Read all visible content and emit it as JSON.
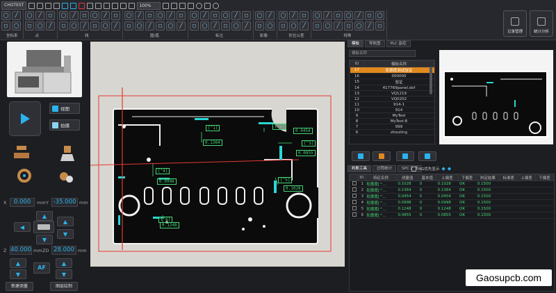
{
  "app": {
    "name": "CHOTEST",
    "zoom": "100%"
  },
  "toolbar": {
    "groups": [
      {
        "label": "坐标系",
        "icons": [
          "axis",
          "axis",
          "axis",
          "axis"
        ]
      },
      {
        "label": "点",
        "icons": [
          "point",
          "point",
          "point",
          "point",
          "point",
          "point"
        ]
      },
      {
        "label": "线",
        "icons": [
          "line",
          "line",
          "line",
          "line",
          "line",
          "line",
          "line",
          "line",
          "line",
          "line",
          "line",
          "line"
        ]
      },
      {
        "label": "圆/弧",
        "icons": [
          "circle",
          "circle",
          "circle",
          "circle",
          "circle",
          "circle",
          "circle",
          "circle",
          "circle",
          "circle",
          "circle",
          "circle"
        ]
      },
      {
        "label": "标注",
        "icons": [
          "dim",
          "dim",
          "dim",
          "dim",
          "dim",
          "dim",
          "dim",
          "dim",
          "dim",
          "dim",
          "dim",
          "dim"
        ]
      },
      {
        "label": "影像",
        "icons": [
          "img",
          "img",
          "img",
          "img"
        ]
      },
      {
        "label": "形位公差",
        "icons": [
          "tol",
          "tol",
          "tol",
          "tol",
          "tol",
          "tol"
        ]
      },
      {
        "label": "特殊",
        "icons": [
          "spec",
          "spec",
          "spec",
          "spec",
          "spec",
          "spec",
          "spec",
          "spec",
          "spec",
          "spec",
          "spec",
          "spec",
          "spec",
          "spec"
        ]
      }
    ],
    "right_buttons": [
      "记录管理",
      "统计分析"
    ]
  },
  "left": {
    "view_button": "视图",
    "shoot_button": "拍摄",
    "x_label": "X",
    "x_value": "0.000",
    "x_unit": "mm",
    "y_label": "Y",
    "y_value": "-35.000",
    "y_unit": "mm",
    "z_label": "Z",
    "z_value": "40.000",
    "z_unit": "mm",
    "zd_label": "ZD",
    "zd_value": "28.000",
    "zd_unit": "mm",
    "af_label": "AF",
    "new_measure": "新建测量",
    "image_measure": "图层绘制"
  },
  "canvas": {
    "measurements": [
      "0.1364",
      "0.0454",
      "0.0855",
      "0.0998",
      "0.1028",
      "0.1248"
    ],
    "labels": [
      "[^1]",
      "[^2]",
      "[^3]",
      "[^4]",
      "[^5]",
      "[^6]"
    ]
  },
  "right": {
    "tabs_top": [
      "模板",
      "导航图",
      "PLC 监控"
    ],
    "template_search_placeholder": "模板名称",
    "tmpl_headers": [
      "ID",
      "模板名称"
    ],
    "templates": [
      {
        "id": "17",
        "name": "轮廓度测试验证"
      },
      {
        "id": "16",
        "name": "000000"
      },
      {
        "id": "15",
        "name": "验证"
      },
      {
        "id": "14",
        "name": "417769panel.dxf"
      },
      {
        "id": "13",
        "name": "VQ1219"
      },
      {
        "id": "12",
        "name": "VQ0202"
      },
      {
        "id": "11",
        "name": "914-1"
      },
      {
        "id": "10",
        "name": "914"
      },
      {
        "id": "9",
        "name": "MyTest"
      },
      {
        "id": "8",
        "name": "MyTest-8"
      },
      {
        "id": "7",
        "name": "999"
      },
      {
        "id": "6",
        "name": "zhouting"
      }
    ],
    "tabs_bottom": [
      "判断工具",
      "过程统计",
      "SPC 曲线"
    ],
    "ng_label": "NG优先显示",
    "res_headers": [
      "",
      "ID",
      "特征名称",
      "测量值",
      "基本值",
      "上偏差",
      "下偏差",
      "判定结果",
      "标准差",
      "上偏差",
      "下偏差"
    ],
    "results": [
      {
        "id": "1",
        "name": "轮廓度[^...",
        "meas": "0.1028",
        "base": "0",
        "lim": "0.1028",
        "res": "OK",
        "tol": "0.1500"
      },
      {
        "id": "2",
        "name": "轮廓度[^...",
        "meas": "0.1364",
        "base": "0",
        "lim": "0.1364",
        "res": "OK",
        "tol": "0.1500"
      },
      {
        "id": "3",
        "name": "轮廓度[^...",
        "meas": "0.0454",
        "base": "0",
        "lim": "0.0454",
        "res": "OK",
        "tol": "0.1500"
      },
      {
        "id": "4",
        "name": "轮廓度[^...",
        "meas": "0.0998",
        "base": "0",
        "lim": "0.0998",
        "res": "OK",
        "tol": "0.1500"
      },
      {
        "id": "5",
        "name": "轮廓度[^...",
        "meas": "0.1248",
        "base": "0",
        "lim": "0.1248",
        "res": "OK",
        "tol": "0.1500"
      },
      {
        "id": "6",
        "name": "轮廓度[^...",
        "meas": "0.0855",
        "base": "0",
        "lim": "0.0855",
        "res": "OK",
        "tol": "0.1500"
      }
    ],
    "watermark": "Gaosupcb.com"
  },
  "colors": {
    "accent": "#2ab3ec",
    "selected_row": "#e0891f",
    "ok_text": "#49d97a",
    "bbox_red": "#e53935"
  }
}
